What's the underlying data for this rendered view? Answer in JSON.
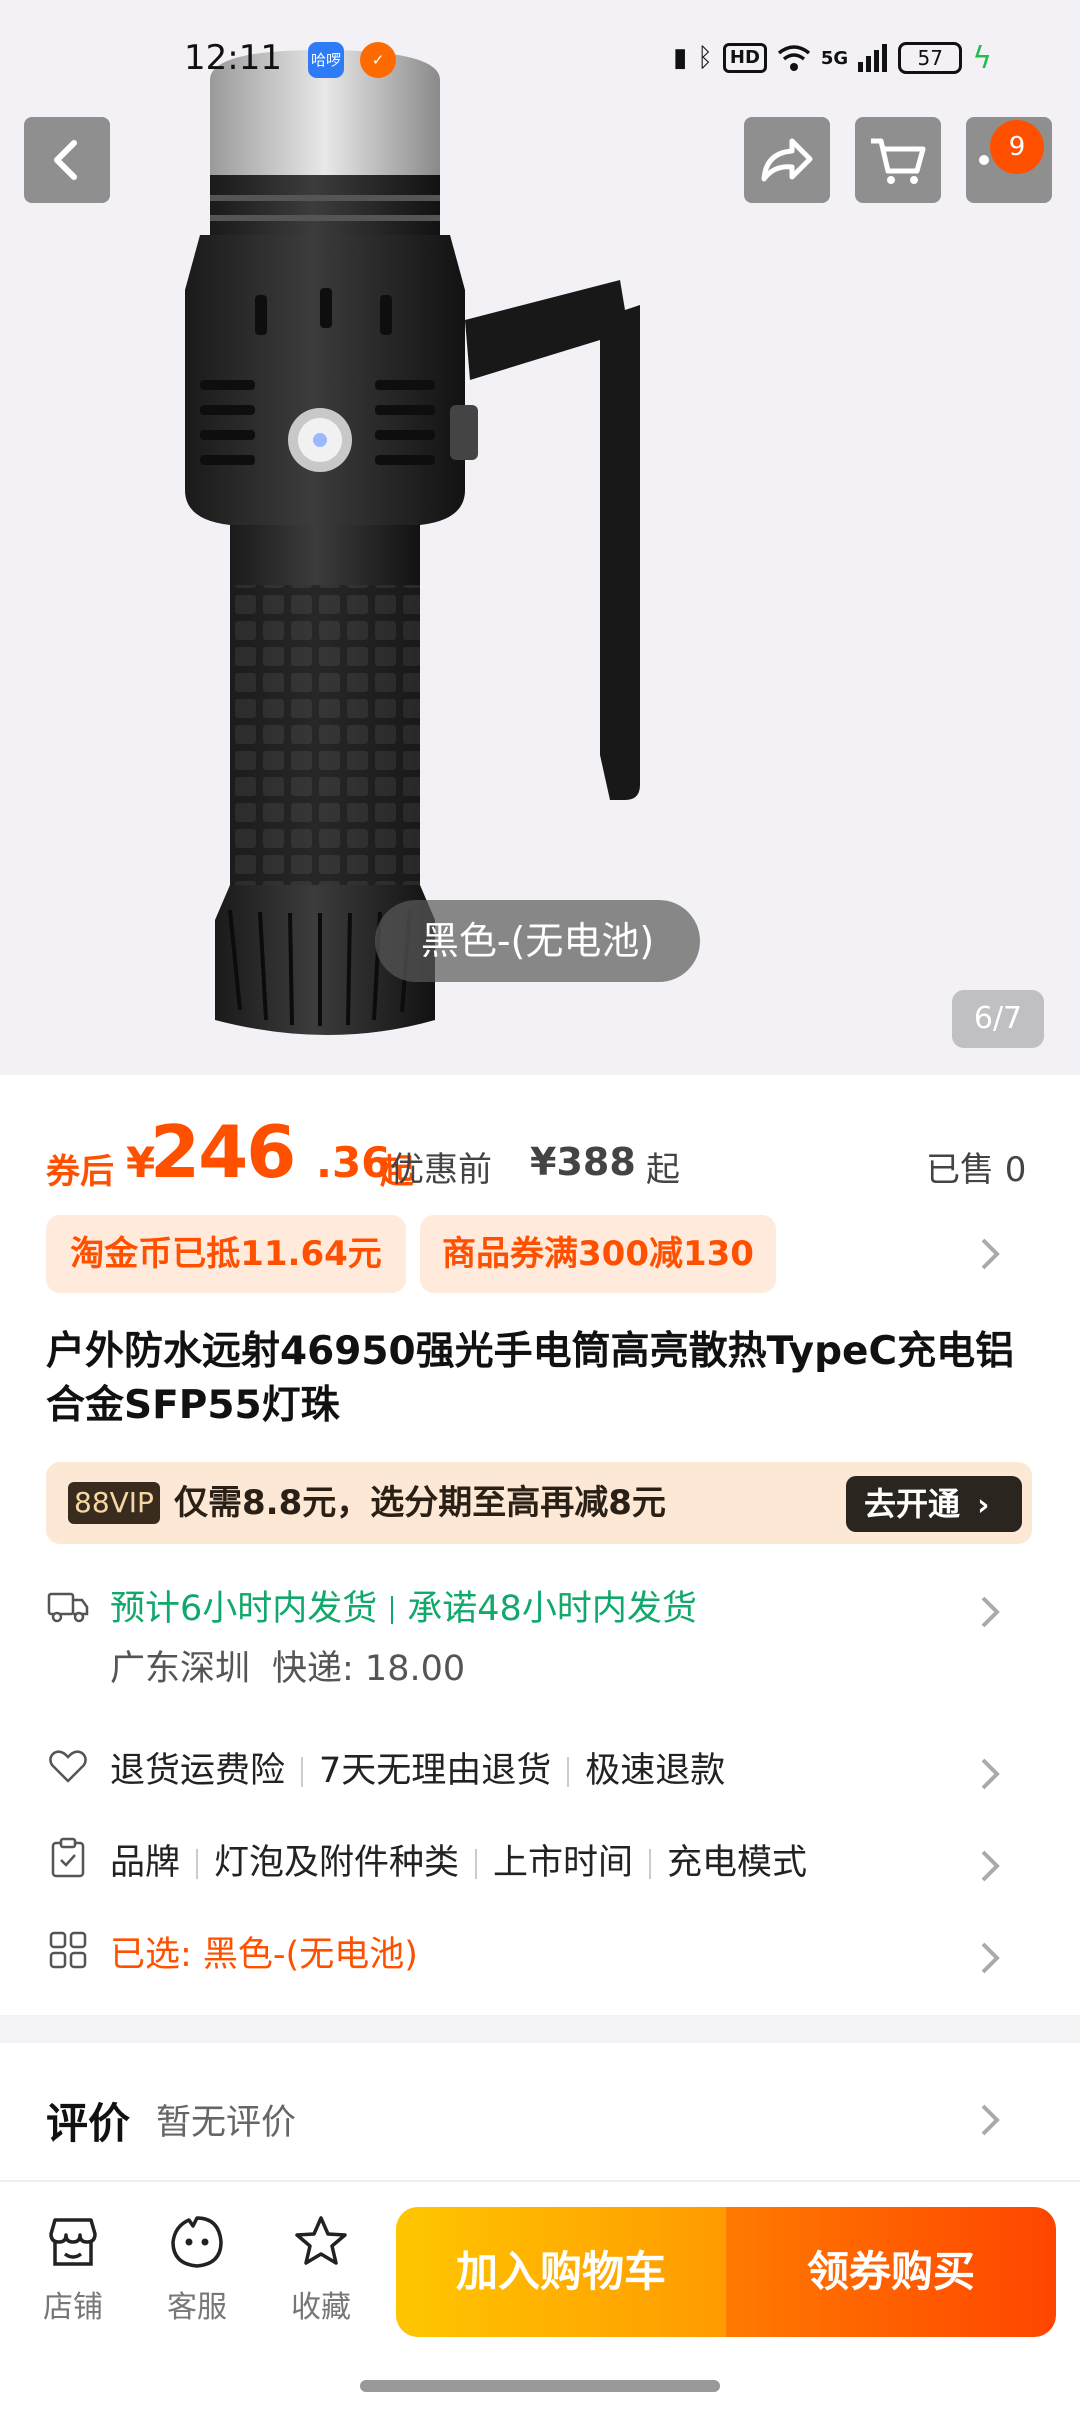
{
  "status_bar": {
    "time": "12:11",
    "app_icons": [
      "哈啰",
      "✓"
    ],
    "network": "5G",
    "hd": "HD",
    "battery": "57"
  },
  "hero": {
    "variant": "黑色-(无电池)",
    "counter": "6/7",
    "cart_badge": "9"
  },
  "price": {
    "after_label": "券后",
    "currency": "¥",
    "integer": "246",
    "decimal": ".36",
    "qi": "起",
    "before_label": "优惠前",
    "before_value": "¥388",
    "before_qi": "起",
    "sold": "已售 0"
  },
  "coupons": [
    "淘金币已抵11.64元",
    "商品券满300减130"
  ],
  "title": "户外防水远射46950强光手电筒高亮散热TypeC充电铝合金SFP55灯珠",
  "vip": {
    "tag": "88VIP",
    "text": "仅需8.8元，选分期至高再减8元",
    "button": "去开通"
  },
  "shipping": {
    "line1_a": "预计6小时内发货",
    "line1_b": "承诺48小时内发货",
    "origin": "广东深圳",
    "express": "快递: 18.00"
  },
  "guarantee": [
    "退货运费险",
    "7天无理由退货",
    "极速退款"
  ],
  "params": [
    "品牌",
    "灯泡及附件种类",
    "上市时间",
    "充电模式"
  ],
  "selected": "已选: 黑色-(无电池)",
  "review": {
    "title": "评价",
    "empty": "暂无评价"
  },
  "bottom": {
    "shop": "店铺",
    "service": "客服",
    "favorite": "收藏",
    "add_cart": "加入购物车",
    "buy": "领券购买"
  },
  "colors": {
    "accent": "#ff5000",
    "green": "#11a86b",
    "cart_gradient": [
      "#ffc600",
      "#ff9a00"
    ],
    "buy_gradient": [
      "#ff7a00",
      "#ff4500"
    ]
  }
}
